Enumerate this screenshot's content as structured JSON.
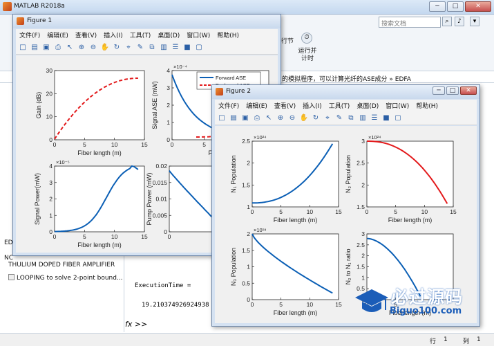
{
  "main": {
    "title": "MATLAB R2018a",
    "search_placeholder": "搜索文档",
    "ribbon_run_section": "运行并\n计时",
    "ribbon_run_section_top": "行节",
    "path_text": "的模拟程序，可以计算光纤的ASE成分 » EDFA",
    "left_items": [
      "THULIUM DOPED FIBER AMPLIFIER",
      "LOOPING to solve 2-point bound..."
    ],
    "left_header_1": "ED",
    "left_header_2": "NC",
    "cmd_line_1": "ExecutionTime =",
    "cmd_line_2": "19.210374926924938",
    "cmd_prompt": "fx >>",
    "status_line": "行",
    "status_line_val": "1",
    "status_col": "列",
    "status_col_val": "1"
  },
  "fig1": {
    "title": "Figure 1",
    "menu": [
      "文件(F)",
      "编辑(E)",
      "查看(V)",
      "插入(I)",
      "工具(T)",
      "桌面(D)",
      "窗口(W)",
      "帮助(H)"
    ],
    "axes": [
      {
        "ylabel": "Gain (dB)",
        "xlabel": "Fiber length (m)",
        "xticks": [
          "0",
          "5",
          "10",
          "15"
        ],
        "yticks": [
          "0",
          "10",
          "20",
          "30"
        ],
        "exponent": ""
      },
      {
        "ylabel": "Signal ASE (mW)",
        "xlabel": "Fiber len",
        "xticks": [
          "0",
          "5"
        ],
        "yticks": [
          "0",
          "1",
          "2",
          "3",
          "4"
        ],
        "exponent": "×10⁻⁴",
        "legend": [
          "Forward ASE",
          "Backward ASE"
        ]
      },
      {
        "ylabel": "Signal Power(mW)",
        "xlabel": "Fiber length (m)",
        "xticks": [
          "0",
          "5",
          "10",
          "15"
        ],
        "yticks": [
          "0",
          "1",
          "2",
          "3",
          "4"
        ],
        "exponent": "×10⁻⁵"
      },
      {
        "ylabel": "Pump Power (mW)",
        "xlabel": "",
        "xticks": [
          "0"
        ],
        "yticks": [
          "0",
          "0.005",
          "0.01",
          "0.015",
          "0.02"
        ],
        "exponent": ""
      }
    ]
  },
  "fig2": {
    "title": "Figure 2",
    "menu": [
      "文件(F)",
      "编辑(E)",
      "查看(V)",
      "插入(I)",
      "工具(T)",
      "桌面(D)",
      "窗口(W)",
      "帮助(H)"
    ],
    "axes": [
      {
        "ylabel": "N₁ Population",
        "xlabel": "Fiber length (m)",
        "xticks": [
          "0",
          "5",
          "10",
          "15"
        ],
        "yticks": [
          "1",
          "1.5",
          "2",
          "2.5"
        ],
        "exponent": "×10²⁴"
      },
      {
        "ylabel": "N₂ Population",
        "xlabel": "Fiber length (m)",
        "xticks": [
          "0",
          "5",
          "10",
          "15"
        ],
        "yticks": [
          "1.5",
          "2",
          "2.5",
          "3"
        ],
        "exponent": "×10²⁴"
      },
      {
        "ylabel": "N₃ Population",
        "xlabel": "Fiber length (m)",
        "xticks": [
          "0",
          "5",
          "10",
          "15"
        ],
        "yticks": [
          "0",
          "0.5",
          "1",
          "1.5",
          "2"
        ],
        "exponent": "×10¹⁸"
      },
      {
        "ylabel": "N₂ to N₁ ratio",
        "xlabel": "Fiberlength (m)",
        "xticks": [
          "0",
          "5"
        ],
        "yticks": [
          "0",
          "0.5",
          "1",
          "1.5",
          "2",
          "2.5",
          "3"
        ],
        "exponent": ""
      }
    ]
  },
  "watermark": {
    "text": "必过源码",
    "url": "Biguo100.com"
  },
  "colors": {
    "blue": "#0b5fb5",
    "red": "#e31a1c",
    "accent": "#1b5db8"
  }
}
